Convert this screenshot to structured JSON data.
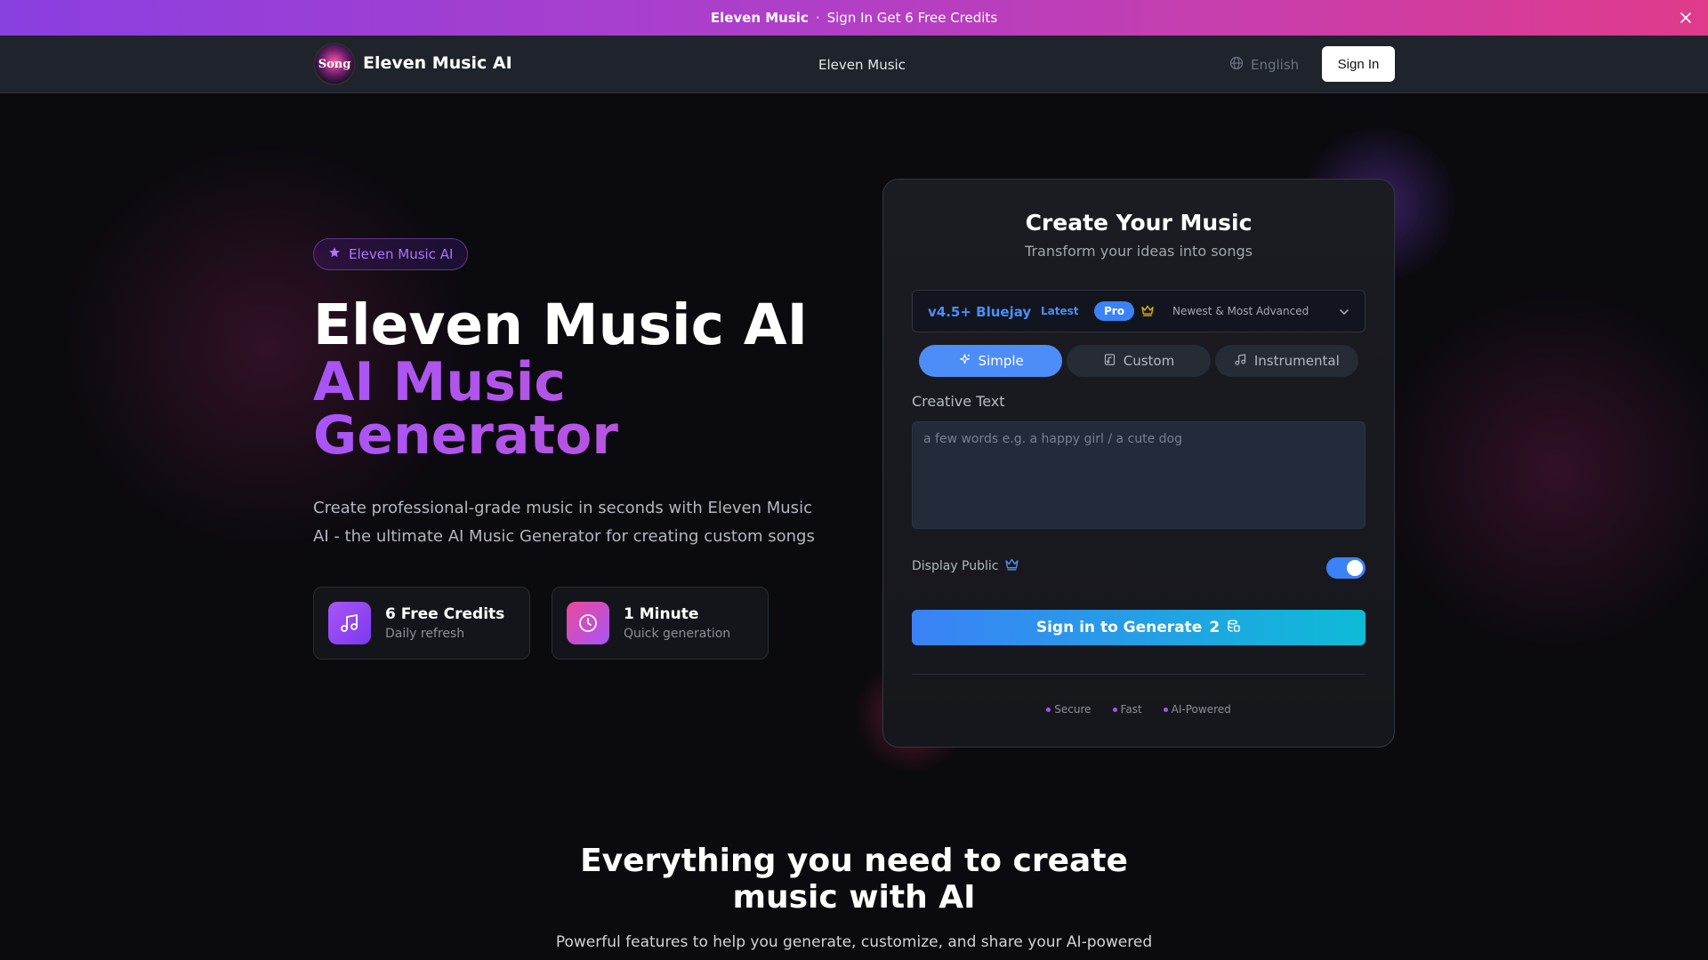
{
  "announcement": {
    "brand": "Eleven Music",
    "separator": "·",
    "message": "Sign In Get 6 Free Credits"
  },
  "nav": {
    "logo_text": "Song",
    "site_name": "Eleven Music AI",
    "center_link": "Eleven Music",
    "language": "English",
    "sign_in": "Sign In"
  },
  "hero": {
    "badge": "Eleven Music AI",
    "title": "Eleven Music AI",
    "title_gradient_line1": "AI Music",
    "title_gradient_line2": "Generator",
    "description": "Create professional-grade music in seconds with Eleven Music AI - the ultimate AI Music Generator for creating custom songs",
    "stats": [
      {
        "title": "6 Free Credits",
        "subtitle": "Daily refresh"
      },
      {
        "title": "1 Minute",
        "subtitle": "Quick generation"
      }
    ]
  },
  "card": {
    "title": "Create Your Music",
    "subtitle": "Transform your ideas into songs",
    "model": {
      "name": "v4.5+ Bluejay",
      "tag_latest": "Latest",
      "tag_pro": "Pro",
      "description": "Newest & Most Advanced"
    },
    "tabs": [
      {
        "label": "Simple",
        "active": true
      },
      {
        "label": "Custom",
        "active": false
      },
      {
        "label": "Instrumental",
        "active": false
      }
    ],
    "creative_text_label": "Creative Text",
    "creative_text_placeholder": "a few words e.g. a happy girl / a cute dog",
    "creative_text_value": "",
    "display_public_label": "Display Public",
    "display_public_on": true,
    "generate_label": "Sign in to Generate",
    "generate_cost": "2",
    "features": [
      "Secure",
      "Fast",
      "AI-Powered"
    ]
  },
  "section": {
    "title_line1": "Everything you need to create",
    "title_line2": "music with AI",
    "subtitle": "Powerful features to help you generate, customize, and share your AI-powered"
  },
  "colors": {
    "accent_blue": "#3b82f6",
    "accent_purple": "#a855f7",
    "banner_start": "#8a3fe0",
    "banner_end": "#e03b8b",
    "background": "#0b0a0f"
  }
}
